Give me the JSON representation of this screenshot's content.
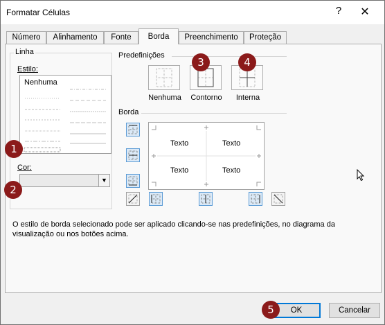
{
  "window": {
    "title": "Formatar Células",
    "help": "?",
    "close": "✕"
  },
  "tabs": [
    {
      "label": "Número"
    },
    {
      "label": "Alinhamento"
    },
    {
      "label": "Fonte"
    },
    {
      "label": "Borda",
      "active": true
    },
    {
      "label": "Preenchimento"
    },
    {
      "label": "Proteção"
    }
  ],
  "linha": {
    "group_label": "Linha",
    "estilo_label": "Estilo:",
    "estilo_selected": "Nenhuma",
    "cor_label": "Cor:"
  },
  "predefinicoes": {
    "label": "Predefinições",
    "items": [
      {
        "label": "Nenhuma"
      },
      {
        "label": "Contorno"
      },
      {
        "label": "Interna"
      }
    ]
  },
  "borda": {
    "label": "Borda",
    "preview_texts": [
      "Texto",
      "Texto",
      "Texto",
      "Texto"
    ]
  },
  "note": "O estilo de borda selecionado pode ser aplicado clicando-se nas predefinições, no diagrama da visualização ou nos botões acima.",
  "buttons": {
    "ok": "OK",
    "cancel": "Cancelar"
  },
  "callouts": [
    "1",
    "2",
    "3",
    "4",
    "5"
  ],
  "colors": {
    "accent": "#0078d7",
    "callout": "#8b1a1a",
    "highlight": "#5b9bd5"
  }
}
